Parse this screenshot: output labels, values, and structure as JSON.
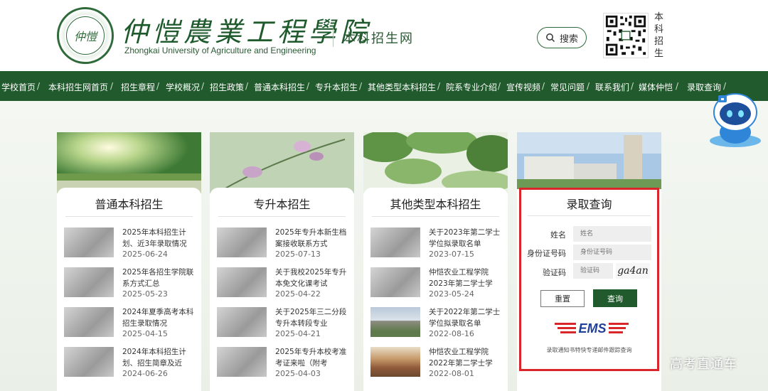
{
  "header": {
    "logo_text": "仲愷",
    "school_name_cn": "仲愷農業工程學院",
    "school_name_en": "Zhongkai University of Agriculture and Engineering",
    "subsite": "本科招生网",
    "search_label": "搜索",
    "qr_label": "本科招生",
    "search_icon": "search-icon",
    "brand_green": "#215a2c"
  },
  "nav": {
    "items": [
      "学校首页",
      "本科招生网首页",
      "招生章程",
      "学校概况",
      "招生政策",
      "普通本科招生",
      "专升本招生",
      "其他类型本科招生",
      "院系专业介绍",
      "宣传视频",
      "常见问题",
      "联系我们",
      "媒体仲恺",
      "录取查询"
    ],
    "separator": "/"
  },
  "cards": [
    {
      "title": "普通本科招生",
      "items": [
        {
          "title": "2025年本科招生计划、近3年录取情况",
          "date": "2025-06-24"
        },
        {
          "title": "2025年各招生学院联系方式汇总",
          "date": "2025-05-23"
        },
        {
          "title": "2024年夏季高考本科招生录取情况",
          "date": "2025-04-15"
        },
        {
          "title": "2024年本科招生计划、招生简章及近",
          "date": "2024-06-26"
        }
      ]
    },
    {
      "title": "专升本招生",
      "items": [
        {
          "title": "2025年专升本新生档案接收联系方式",
          "date": "2025-07-13"
        },
        {
          "title": "关于我校2025年专升本免文化课考试",
          "date": "2025-04-22"
        },
        {
          "title": "关于2025年三二分段专升本转段专业",
          "date": "2025-04-21"
        },
        {
          "title": "2025年专升本校考准考证来啦（附考",
          "date": "2025-04-03"
        }
      ]
    },
    {
      "title": "其他类型本科招生",
      "items": [
        {
          "title": "关于2023年第二学士学位拟录取名单",
          "date": "2023-07-15"
        },
        {
          "title": "仲恺农业工程学院2023年第二学士学",
          "date": "2023-05-24"
        },
        {
          "title": "关于2022年第二学士学位拟录取名单",
          "date": "2022-08-16"
        },
        {
          "title": "仲恺农业工程学院2022年第二学士学",
          "date": "2022-08-01"
        }
      ]
    }
  ],
  "query": {
    "title": "录取查询",
    "name_label": "姓名",
    "name_placeholder": "姓名",
    "id_label": "身份证号码",
    "id_placeholder": "身份证号码",
    "captcha_label": "验证码",
    "captcha_placeholder": "验证码",
    "captcha_text": "ga4an",
    "reset_label": "重置",
    "submit_label": "查询",
    "ems_logo": "EMS",
    "note": "录取通知书特快专递邮件跟踪查询",
    "highlight_color": "#d8262b"
  },
  "robot_icon": "robot-assistant-icon",
  "watermark": "高考直通车"
}
